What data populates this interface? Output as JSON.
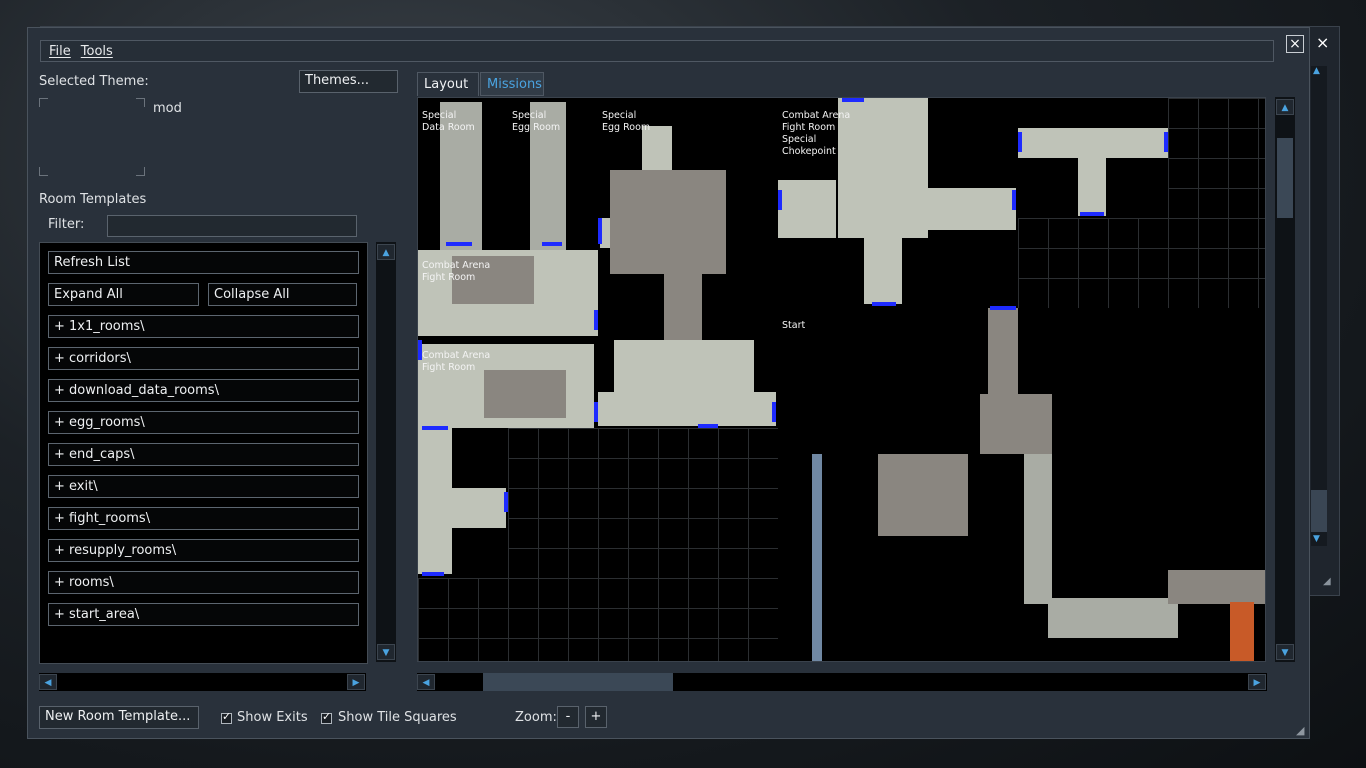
{
  "menu": {
    "file": "File",
    "tools": "Tools"
  },
  "theme": {
    "selected_label": "Selected Theme:",
    "themes_button": "Themes...",
    "theme_name": "mod"
  },
  "templates": {
    "header": "Room Templates",
    "filter_label": "Filter:",
    "filter_value": "",
    "refresh": "Refresh List",
    "expand": "Expand All",
    "collapse": "Collapse All",
    "folders": [
      "+ 1x1_rooms\\",
      "+ corridors\\",
      "+ download_data_rooms\\",
      "+ egg_rooms\\",
      "+ end_caps\\",
      "+ exit\\",
      "+ fight_rooms\\",
      "+ resupply_rooms\\",
      "+ rooms\\",
      "+ start_area\\"
    ]
  },
  "tabs": {
    "layout": "Layout",
    "missions": "Missions"
  },
  "map": {
    "labels": {
      "special_data": "Special\nData Room",
      "special_egg_1": "Special\nEgg Room",
      "special_egg_2": "Special\nEgg Room",
      "combat_fight": "Combat Arena\nFight Room\nSpecial\nChokepoint",
      "combat_arena_1": "Combat Arena\nFight Room",
      "combat_arena_2": "Combat Arena\nFight Room",
      "start": "Start"
    }
  },
  "bottom": {
    "new_room": "New Room Template...",
    "show_exits": "Show Exits",
    "show_tile_squares": "Show Tile Squares",
    "zoom_label": "Zoom:",
    "zoom_out": "-",
    "zoom_in": "+"
  },
  "icons": {
    "close": "×"
  },
  "colors": {
    "accent": "#4aa3e0",
    "exit": "#1e2bff",
    "background": "#29313b"
  }
}
